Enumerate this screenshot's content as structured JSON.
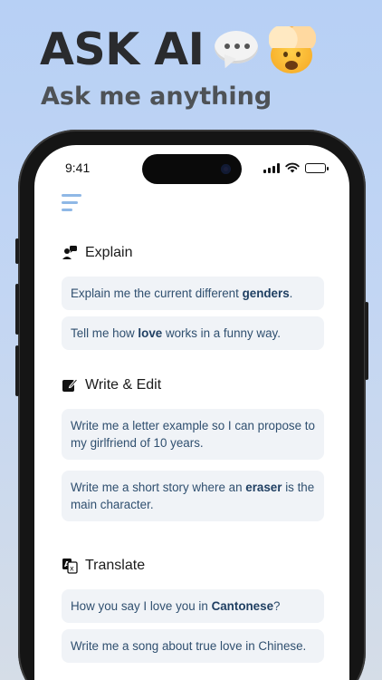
{
  "hero": {
    "title": "ASK AI",
    "subtitle": "Ask me anything",
    "emojis": [
      "speech-bubble-icon",
      "mind-blown-icon"
    ]
  },
  "status_bar": {
    "time": "9:41"
  },
  "colors": {
    "accent": "#8fb8e6",
    "card_bg": "#f0f3f7",
    "card_text": "#2f4f6f"
  },
  "sections": [
    {
      "title": "Explain",
      "icon": "person-speech-icon",
      "prompts": [
        {
          "before": "Explain me the current different ",
          "bold": "genders",
          "after": "."
        },
        {
          "before": "Tell me how ",
          "bold": "love",
          "after": " works in a funny way."
        }
      ]
    },
    {
      "title": "Write & Edit",
      "icon": "edit-icon",
      "prompts": [
        {
          "before": "Write me a letter example so I can propose to my girlfriend of 10 years.",
          "bold": "",
          "after": ""
        },
        {
          "before": "Write me a short story where an ",
          "bold": "eraser",
          "after": " is the main character."
        }
      ]
    },
    {
      "title": "Translate",
      "icon": "translate-icon",
      "prompts": [
        {
          "before": "How you say I love you in ",
          "bold": "Cantonese",
          "after": "?"
        },
        {
          "before": "Write me a song about true love in Chinese.",
          "bold": "",
          "after": ""
        }
      ]
    }
  ]
}
